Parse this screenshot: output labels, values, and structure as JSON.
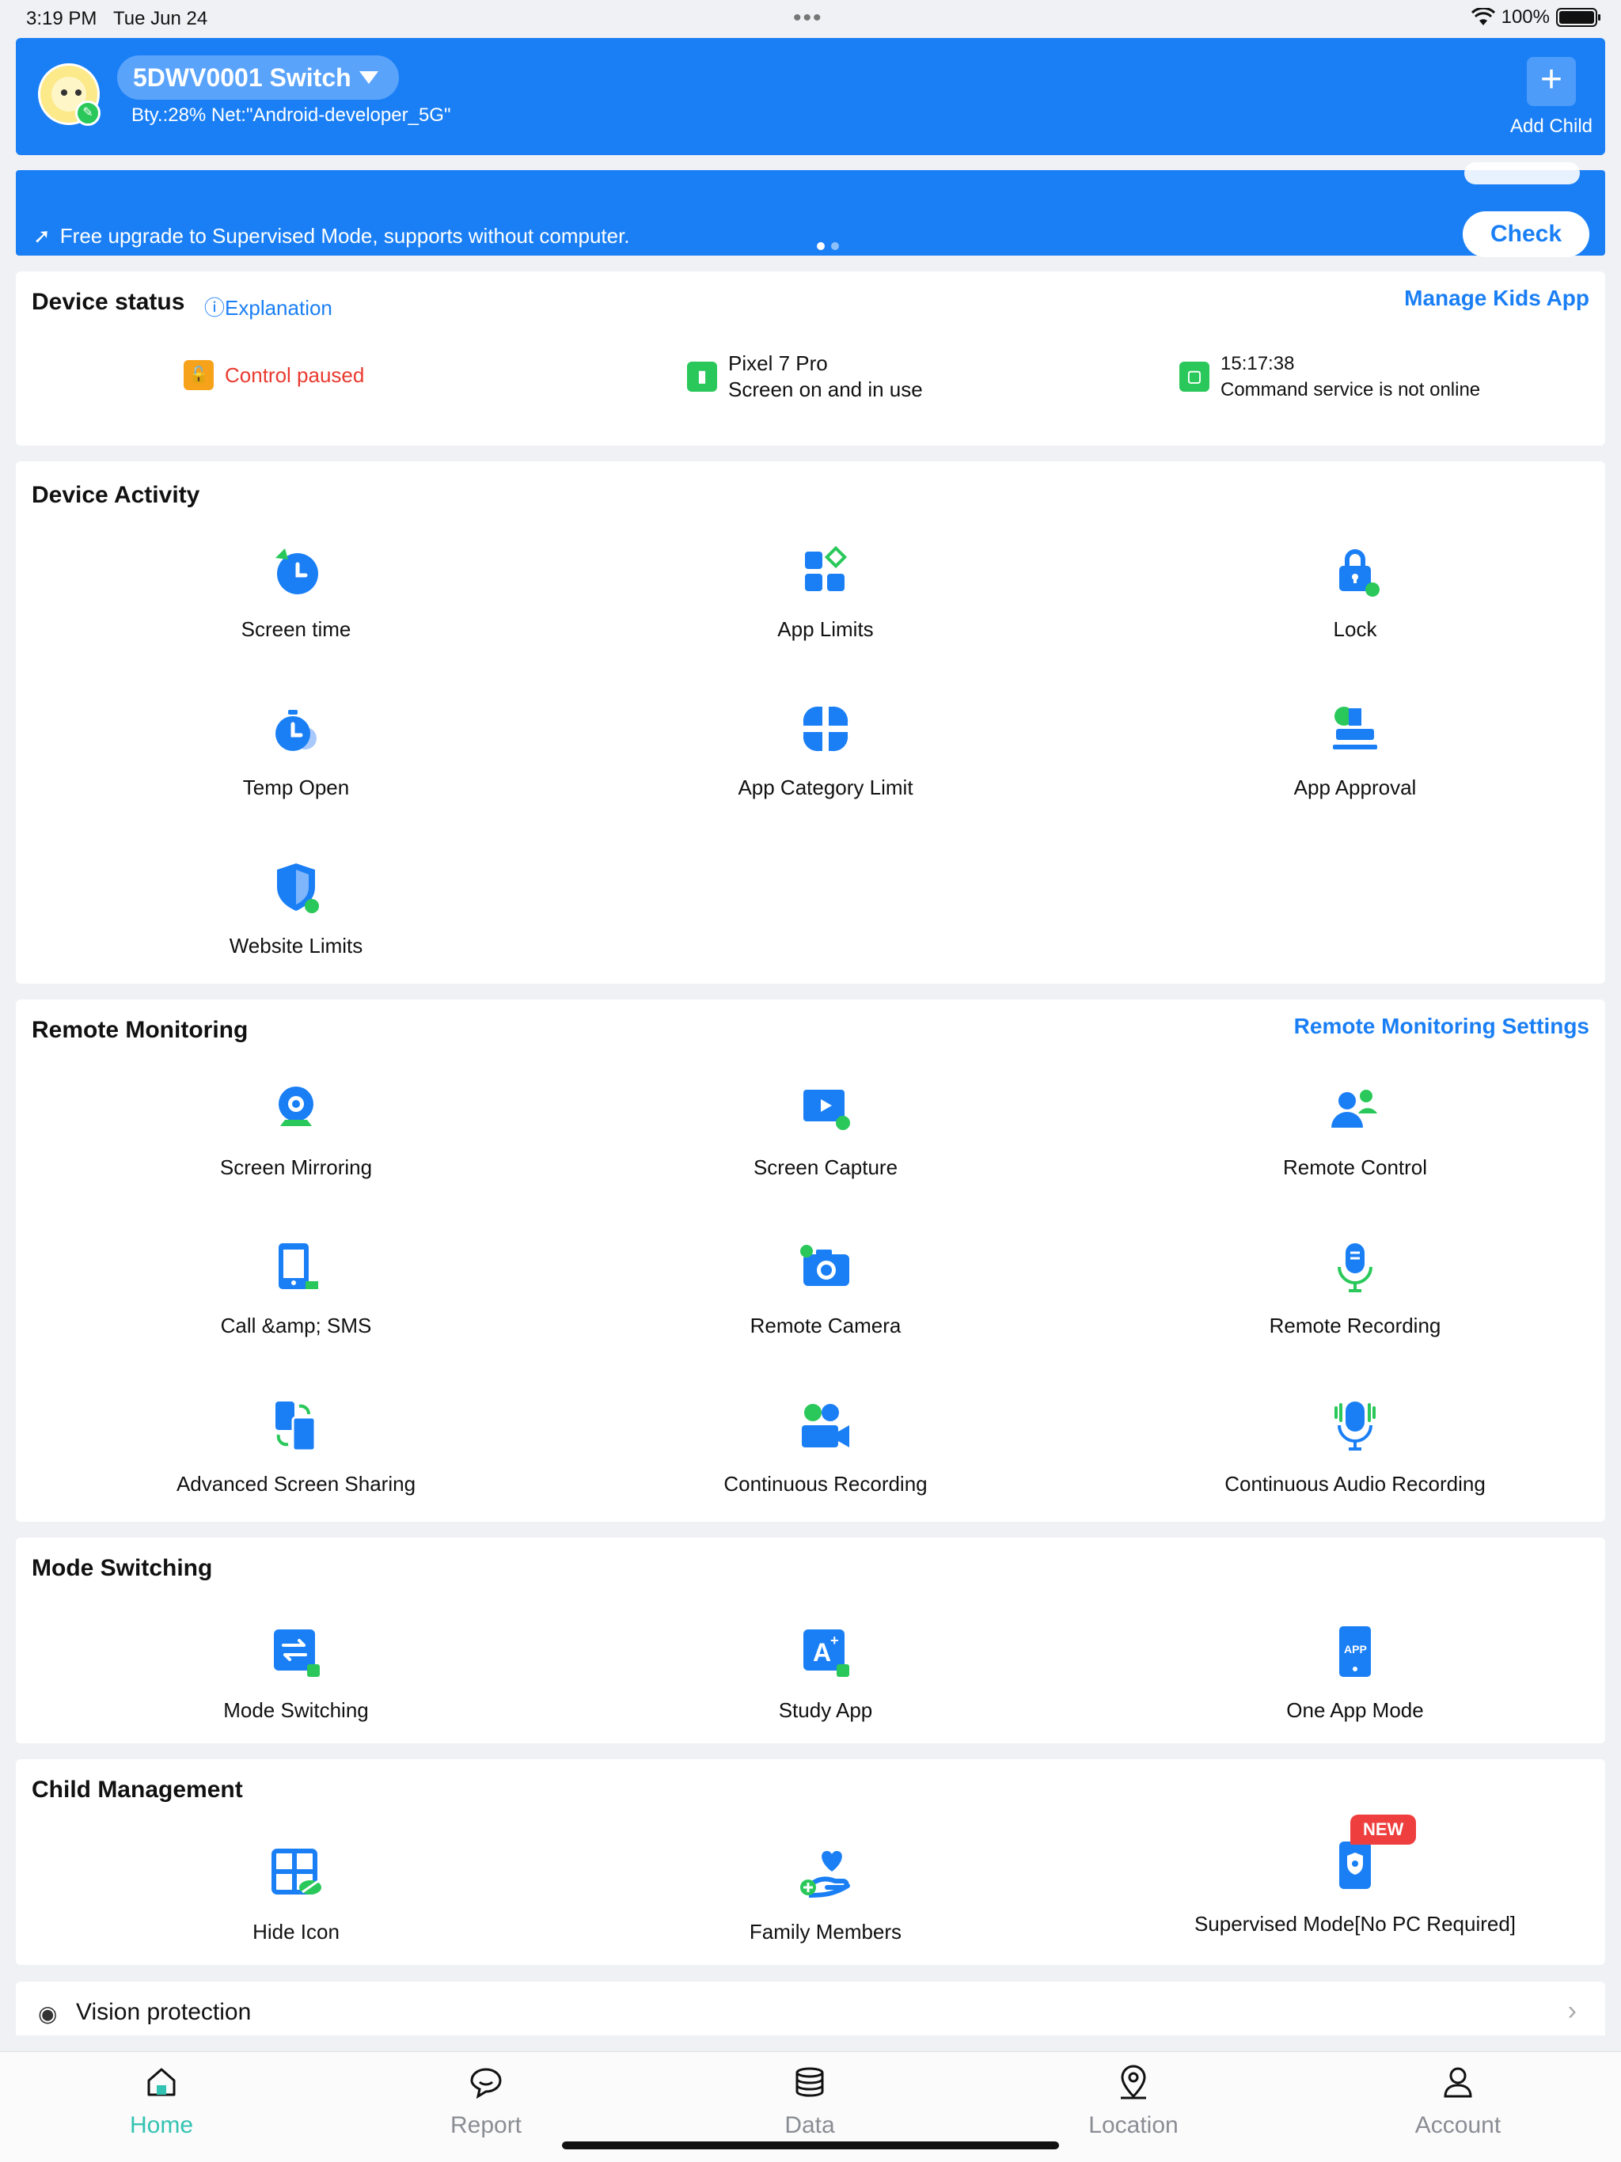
{
  "status_bar": {
    "time": "3:19 PM",
    "date": "Tue Jun 24",
    "battery": "100%"
  },
  "header": {
    "device_name": "5DWV0001 Switch",
    "device_info": "Bty.:28% Net:\"Android-developer_5G\"",
    "add_child_label": "Add Child"
  },
  "banner": {
    "text": "Free upgrade to Supervised Mode, supports without computer.",
    "check_label": "Check"
  },
  "device_status": {
    "title": "Device status",
    "explanation": "Explanation",
    "manage_link": "Manage Kids App",
    "control": "Control paused",
    "device_model": "Pixel 7 Pro",
    "screen_state": "Screen on and in use",
    "time": "15:17:38",
    "command_state": "Command service is not online"
  },
  "device_activity": {
    "title": "Device Activity",
    "items": [
      {
        "label": "Screen time",
        "icon": "clock-icon"
      },
      {
        "label": "App Limits",
        "icon": "apps-grid-icon"
      },
      {
        "label": "Lock",
        "icon": "padlock-icon"
      },
      {
        "label": "Temp Open",
        "icon": "stopwatch-icon"
      },
      {
        "label": "App Category Limit",
        "icon": "category-icon"
      },
      {
        "label": "App Approval",
        "icon": "stamp-icon"
      },
      {
        "label": "Website Limits",
        "icon": "shield-icon"
      }
    ]
  },
  "remote_monitoring": {
    "title": "Remote Monitoring",
    "settings_link": "Remote Monitoring Settings",
    "items": [
      {
        "label": "Screen Mirroring",
        "icon": "webcam-icon"
      },
      {
        "label": "Screen Capture",
        "icon": "play-screen-icon"
      },
      {
        "label": "Remote Control",
        "icon": "users-icon"
      },
      {
        "label": "Call &amp; SMS",
        "icon": "phone-message-icon"
      },
      {
        "label": "Remote Camera",
        "icon": "camera-icon"
      },
      {
        "label": "Remote Recording",
        "icon": "microphone-icon"
      },
      {
        "label": "Advanced Screen Sharing",
        "icon": "screen-share-icon"
      },
      {
        "label": "Continuous Recording",
        "icon": "video-call-icon"
      },
      {
        "label": "Continuous Audio Recording",
        "icon": "audio-mic-icon"
      }
    ]
  },
  "mode_switching": {
    "title": "Mode Switching",
    "items": [
      {
        "label": "Mode Switching",
        "icon": "switch-arrows-icon"
      },
      {
        "label": "Study App",
        "icon": "study-a-plus-icon"
      },
      {
        "label": "One App Mode",
        "icon": "app-phone-icon"
      }
    ]
  },
  "child_management": {
    "title": "Child Management",
    "items": [
      {
        "label": "Hide Icon",
        "icon": "hide-grid-icon"
      },
      {
        "label": "Family Members",
        "icon": "heart-hand-icon"
      },
      {
        "label": "Supervised Mode[No PC Required]",
        "icon": "phone-gear-icon",
        "badge": "NEW"
      }
    ]
  },
  "vision": {
    "label": "Vision protection"
  },
  "tabbar": [
    {
      "label": "Home",
      "icon": "home-icon",
      "active": true
    },
    {
      "label": "Report",
      "icon": "chat-bubble-icon"
    },
    {
      "label": "Data",
      "icon": "database-icon"
    },
    {
      "label": "Location",
      "icon": "map-pin-icon"
    },
    {
      "label": "Account",
      "icon": "person-icon"
    }
  ],
  "colors": {
    "brand_blue": "#1a7ff5",
    "accent_green": "#2ac85a",
    "tab_active": "#34c3b2",
    "alert_red": "#ef3e3e",
    "lock_orange": "#f7a21b"
  }
}
